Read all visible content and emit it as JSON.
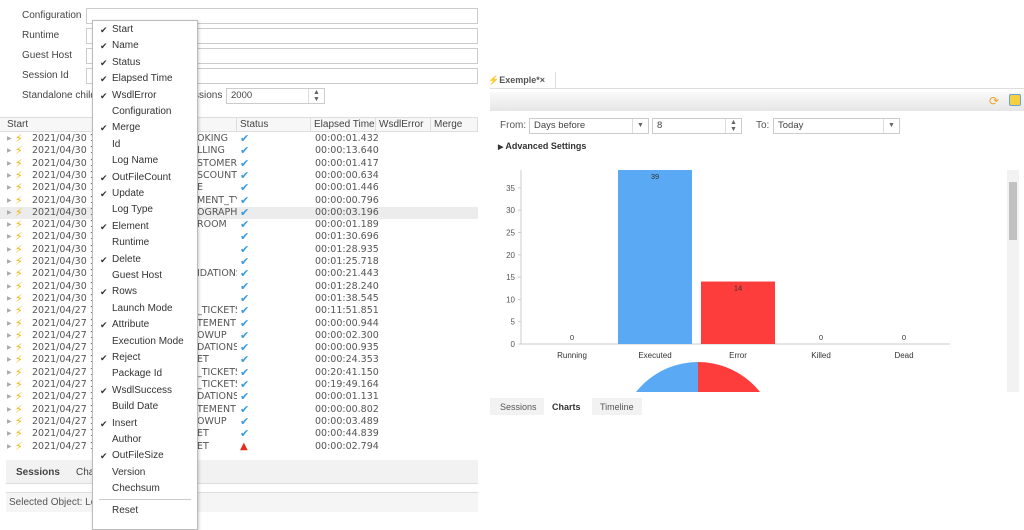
{
  "form": {
    "labels": [
      "Configuration",
      "Runtime",
      "Guest Host",
      "Session Id",
      "Standalone child"
    ],
    "sessions_label_partial": "ssions",
    "max_sessions": "2000"
  },
  "table": {
    "headers": [
      "Start",
      "Status",
      "Elapsed Time",
      "WsdlError",
      "Merge"
    ],
    "rows": [
      {
        "start": "2021/04/30 15",
        "name": "OKING",
        "status": "ok",
        "elapsed": "00:00:01.432"
      },
      {
        "start": "2021/04/30 15",
        "name": "LLING",
        "status": "ok",
        "elapsed": "00:00:13.640"
      },
      {
        "start": "2021/04/30 15",
        "name": "STOMER",
        "status": "ok",
        "elapsed": "00:00:01.417"
      },
      {
        "start": "2021/04/30 15",
        "name": "SCOUNT",
        "status": "ok",
        "elapsed": "00:00:00.634"
      },
      {
        "start": "2021/04/30 15",
        "name": "E",
        "status": "ok",
        "elapsed": "00:00:01.446"
      },
      {
        "start": "2021/04/30 15",
        "name": "MENT_TY",
        "status": "ok",
        "elapsed": "00:00:00.796"
      },
      {
        "start": "2021/04/30 15",
        "name": "OGRAPHY",
        "status": "ok",
        "elapsed": "00:00:03.196",
        "selected": true
      },
      {
        "start": "2021/04/30 15",
        "name": "ROOM",
        "status": "ok",
        "elapsed": "00:00:01.189"
      },
      {
        "start": "2021/04/30 12",
        "name": "",
        "status": "ok",
        "elapsed": "00:01:30.696"
      },
      {
        "start": "2021/04/30 12",
        "name": "",
        "status": "ok",
        "elapsed": "00:01:28.935"
      },
      {
        "start": "2021/04/30 12",
        "name": "",
        "status": "ok",
        "elapsed": "00:01:25.718"
      },
      {
        "start": "2021/04/30 12",
        "name": "IDATIONS",
        "status": "ok",
        "elapsed": "00:00:21.443"
      },
      {
        "start": "2021/04/30 12",
        "name": "",
        "status": "ok",
        "elapsed": "00:01:28.240"
      },
      {
        "start": "2021/04/30 12",
        "name": "",
        "status": "ok",
        "elapsed": "00:01:38.545"
      },
      {
        "start": "2021/04/27 17",
        "name": "_TICKETS",
        "status": "ok",
        "elapsed": "00:11:51.851"
      },
      {
        "start": "2021/04/27 17",
        "name": "TEMENT",
        "status": "ok",
        "elapsed": "00:00:00.944"
      },
      {
        "start": "2021/04/27 17",
        "name": "OWUP",
        "status": "ok",
        "elapsed": "00:00:02.300"
      },
      {
        "start": "2021/04/27 17",
        "name": "DATIONS",
        "status": "ok",
        "elapsed": "00:00:00.935"
      },
      {
        "start": "2021/04/27 17",
        "name": "ET",
        "status": "ok",
        "elapsed": "00:00:24.353"
      },
      {
        "start": "2021/04/27 17",
        "name": "_TICKETS",
        "status": "ok",
        "elapsed": "00:20:41.150"
      },
      {
        "start": "2021/04/27 16",
        "name": "_TICKETS",
        "status": "ok",
        "elapsed": "00:19:49.164"
      },
      {
        "start": "2021/04/27 16",
        "name": "DATIONS",
        "status": "ok",
        "elapsed": "00:00:01.131"
      },
      {
        "start": "2021/04/27 16",
        "name": "TEMENT",
        "status": "ok",
        "elapsed": "00:00:00.802"
      },
      {
        "start": "2021/04/27 16",
        "name": "OWUP",
        "status": "ok",
        "elapsed": "00:00:03.489"
      },
      {
        "start": "2021/04/27 16",
        "name": "ET",
        "status": "ok",
        "elapsed": "00:00:44.839"
      },
      {
        "start": "2021/04/27 16",
        "name": "ET",
        "status": "error",
        "elapsed": "00:00:02.794"
      }
    ]
  },
  "left_tabs": [
    "Sessions",
    "Charts"
  ],
  "status_bar": "Selected Object: Lo",
  "context_menu": {
    "items": [
      {
        "label": "Start",
        "checked": true
      },
      {
        "label": "Name",
        "checked": true
      },
      {
        "label": "Status",
        "checked": true
      },
      {
        "label": "Elapsed Time",
        "checked": true
      },
      {
        "label": "WsdlError",
        "checked": true
      },
      {
        "label": "Configuration",
        "checked": false
      },
      {
        "label": "Merge",
        "checked": true
      },
      {
        "label": "Id",
        "checked": false
      },
      {
        "label": "Log Name",
        "checked": false
      },
      {
        "label": "OutFileCount",
        "checked": true
      },
      {
        "label": "Update",
        "checked": true
      },
      {
        "label": "Log Type",
        "checked": false
      },
      {
        "label": "Element",
        "checked": true
      },
      {
        "label": "Runtime",
        "checked": false
      },
      {
        "label": "Delete",
        "checked": true
      },
      {
        "label": "Guest Host",
        "checked": false
      },
      {
        "label": "Rows",
        "checked": true
      },
      {
        "label": "Launch Mode",
        "checked": false
      },
      {
        "label": "Attribute",
        "checked": true
      },
      {
        "label": "Execution Mode",
        "checked": false
      },
      {
        "label": "Reject",
        "checked": true
      },
      {
        "label": "Package Id",
        "checked": false
      },
      {
        "label": "WsdlSuccess",
        "checked": true
      },
      {
        "label": "Build Date",
        "checked": false
      },
      {
        "label": "Insert",
        "checked": true
      },
      {
        "label": "Author",
        "checked": false
      },
      {
        "label": "OutFileSize",
        "checked": true
      },
      {
        "label": "Version",
        "checked": false
      },
      {
        "label": "Chechsum",
        "checked": false
      }
    ],
    "reset": "Reset",
    "check_glyph": "✔"
  },
  "editor": {
    "tab_title": "Exemple*",
    "close": "×",
    "from_label": "From:",
    "from_value": "Days before",
    "days_value": "8",
    "to_label": "To:",
    "to_value": "Today",
    "advanced": "Advanced Settings",
    "bottom_tabs": [
      "Sessions",
      "Charts",
      "Timeline"
    ],
    "active_tab": "Charts"
  },
  "colors": {
    "executed": "#59a9f5",
    "error": "#fd3c3c",
    "accent": "#f5b400"
  },
  "chart_data": {
    "type": "bar",
    "categories": [
      "Running",
      "Executed",
      "Error",
      "Killed",
      "Dead"
    ],
    "values": [
      0,
      39,
      14,
      0,
      0
    ],
    "ylim": [
      0,
      39
    ],
    "yticks": [
      0,
      5,
      10,
      15,
      20,
      25,
      30,
      35
    ],
    "grid": false,
    "pie": {
      "type": "pie",
      "slices": [
        {
          "category": "Executed",
          "value": 39
        },
        {
          "category": "Error",
          "value": 14
        }
      ]
    }
  }
}
